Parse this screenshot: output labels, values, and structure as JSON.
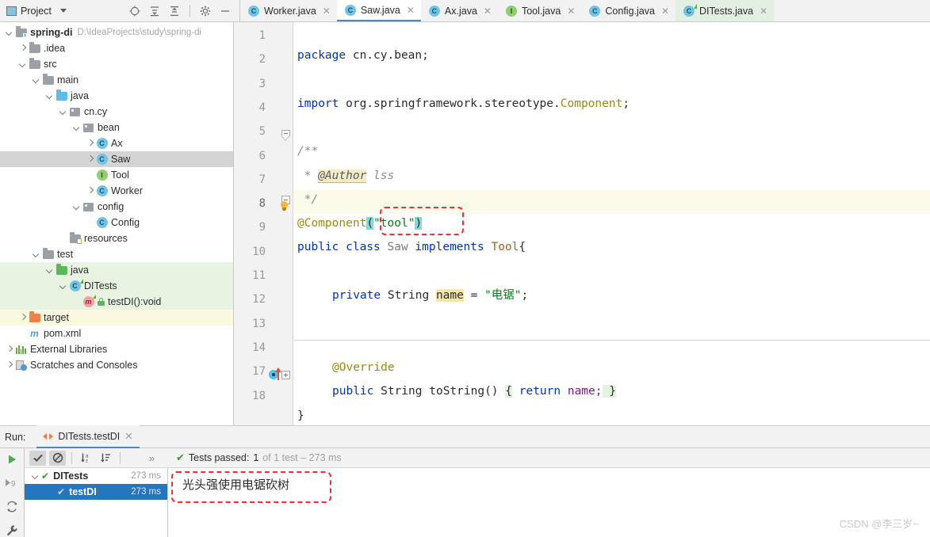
{
  "project_panel": {
    "title": "Project",
    "icons": [
      "locate-icon",
      "expand-all-icon",
      "collapse-all-icon",
      "settings-gear-icon",
      "minimize-icon"
    ],
    "tree": [
      {
        "label": "spring-di",
        "path": "D:\\IdeaProjects\\study\\spring-di",
        "indent": 0,
        "arrow": "down",
        "icon": "module-folder-icon",
        "bold": true,
        "state": "normal"
      },
      {
        "label": ".idea",
        "path": "",
        "indent": 1,
        "arrow": "right",
        "icon": "folder-gray-icon",
        "bold": false,
        "state": "normal"
      },
      {
        "label": "src",
        "path": "",
        "indent": 1,
        "arrow": "down",
        "icon": "folder-gray-icon",
        "bold": false,
        "state": "normal"
      },
      {
        "label": "main",
        "path": "",
        "indent": 2,
        "arrow": "down",
        "icon": "folder-gray-icon",
        "bold": false,
        "state": "normal"
      },
      {
        "label": "java",
        "path": "",
        "indent": 3,
        "arrow": "down",
        "icon": "folder-blue-icon",
        "bold": false,
        "state": "normal"
      },
      {
        "label": "cn.cy",
        "path": "",
        "indent": 4,
        "arrow": "down",
        "icon": "package-icon",
        "bold": false,
        "state": "normal"
      },
      {
        "label": "bean",
        "path": "",
        "indent": 5,
        "arrow": "down",
        "icon": "package-icon",
        "bold": false,
        "state": "normal"
      },
      {
        "label": "Ax",
        "path": "",
        "indent": 6,
        "arrow": "right",
        "icon": "class-icon",
        "bold": false,
        "state": "normal"
      },
      {
        "label": "Saw",
        "path": "",
        "indent": 6,
        "arrow": "right",
        "icon": "class-icon",
        "bold": false,
        "state": "selected"
      },
      {
        "label": "Tool",
        "path": "",
        "indent": 6,
        "arrow": "none",
        "icon": "interface-icon",
        "bold": false,
        "state": "normal"
      },
      {
        "label": "Worker",
        "path": "",
        "indent": 6,
        "arrow": "right",
        "icon": "class-icon",
        "bold": false,
        "state": "normal"
      },
      {
        "label": "config",
        "path": "",
        "indent": 5,
        "arrow": "down",
        "icon": "package-icon",
        "bold": false,
        "state": "normal"
      },
      {
        "label": "Config",
        "path": "",
        "indent": 6,
        "arrow": "none",
        "icon": "class-icon",
        "bold": false,
        "state": "normal"
      },
      {
        "label": "resources",
        "path": "",
        "indent": 4,
        "arrow": "none",
        "icon": "resources-folder-icon",
        "bold": false,
        "state": "normal"
      },
      {
        "label": "test",
        "path": "",
        "indent": 2,
        "arrow": "down",
        "icon": "folder-gray-icon",
        "bold": false,
        "state": "normal"
      },
      {
        "label": "java",
        "path": "",
        "indent": 3,
        "arrow": "down",
        "icon": "folder-green-icon",
        "bold": false,
        "state": "green"
      },
      {
        "label": "DITests",
        "path": "",
        "indent": 4,
        "arrow": "down",
        "icon": "test-class-icon",
        "bold": false,
        "state": "green"
      },
      {
        "label": "testDI():void",
        "path": "",
        "indent": 5,
        "arrow": "none",
        "icon": "test-method-icon",
        "bold": false,
        "state": "green"
      },
      {
        "label": "target",
        "path": "",
        "indent": 1,
        "arrow": "right",
        "icon": "folder-orange-icon",
        "bold": false,
        "state": "yellow"
      },
      {
        "label": "pom.xml",
        "path": "",
        "indent": 1,
        "arrow": "none",
        "icon": "maven-icon",
        "bold": false,
        "state": "normal"
      },
      {
        "label": "External Libraries",
        "path": "",
        "indent": 0,
        "arrow": "right",
        "icon": "libraries-icon",
        "bold": false,
        "state": "normal"
      },
      {
        "label": "Scratches and Consoles",
        "path": "",
        "indent": 0,
        "arrow": "right",
        "icon": "scratches-icon",
        "bold": false,
        "state": "normal"
      }
    ]
  },
  "editor_tabs": [
    {
      "label": "Worker.java",
      "icon": "class-icon",
      "active": false,
      "highlight": "none"
    },
    {
      "label": "Saw.java",
      "icon": "class-icon",
      "active": true,
      "highlight": "none"
    },
    {
      "label": "Ax.java",
      "icon": "class-icon",
      "active": false,
      "highlight": "none"
    },
    {
      "label": "Tool.java",
      "icon": "interface-icon",
      "active": false,
      "highlight": "none"
    },
    {
      "label": "Config.java",
      "icon": "class-icon",
      "active": false,
      "highlight": "none"
    },
    {
      "label": "DITests.java",
      "icon": "test-class-icon",
      "active": false,
      "highlight": "green"
    }
  ],
  "editor": {
    "filename": "Saw.java",
    "line_numbers": [
      "1",
      "2",
      "3",
      "4",
      "5",
      "6",
      "7",
      "8",
      "9",
      "10",
      "11",
      "12",
      "13",
      "14",
      "17",
      "18"
    ],
    "highlighted_line": "8",
    "lines": {
      "l1_kw": "package",
      "l1_rest": " cn.cy.bean;",
      "l3_kw": "import",
      "l3_pkg": " org.springframework.stereotype.",
      "l3_cls": "Component",
      "l3_semi": ";",
      "l5": "/**",
      "l6_star": " * ",
      "l6_tag": "@Author",
      "l6_val": " lss",
      "l7": " */",
      "l8_ann": "@Component",
      "l8_open": "(",
      "l8_str": "\"tool\"",
      "l8_close": ")",
      "l9_kw1": "public class ",
      "l9_name": "Saw",
      "l9_kw2": " implements ",
      "l9_ifc": "Tool",
      "l9_brace": "{",
      "l11_kw": "private",
      "l11_type": " String ",
      "l11_field": "name",
      "l11_eq": " = ",
      "l11_str": "\"电锯\"",
      "l11_semi": ";",
      "l13_ann": "@Override",
      "l14_kw": "public",
      "l14_type": " String ",
      "l14_method": "toString() ",
      "l14_ob": "{",
      "l14_ret": " return ",
      "l14_name": "name;",
      "l14_cb": " }",
      "l17": "}"
    }
  },
  "run_panel": {
    "label": "Run:",
    "tab_label": "DITests.testDI",
    "side_icons": [
      "rerun-play-icon",
      "rerun-failed-icon",
      "rerun-auto-icon",
      "settings-wrench-icon"
    ],
    "toolbar_icons": [
      "show-passed-icon",
      "show-ignored-icon",
      "sort-alphabetically-icon",
      "sort-by-duration-icon",
      "more-options-icon"
    ],
    "status": {
      "prefix": "Tests passed:",
      "count": "1",
      "suffix": "of 1 test – 273 ms"
    },
    "tests": [
      {
        "name": "DITests",
        "time": "273 ms",
        "selected": false,
        "arrow": "down"
      },
      {
        "name": "testDI",
        "time": "273 ms",
        "selected": true,
        "arrow": "none"
      }
    ],
    "console_output": "光头强使用电锯砍树"
  },
  "watermark": "CSDN @李三岁~",
  "colors": {
    "accent_blue": "#4a86c8",
    "annotation_red": "#f03030",
    "highlight_line": "#fcfae8",
    "green_pass": "#3a9a3a",
    "selection_blue": "#2675bf"
  }
}
